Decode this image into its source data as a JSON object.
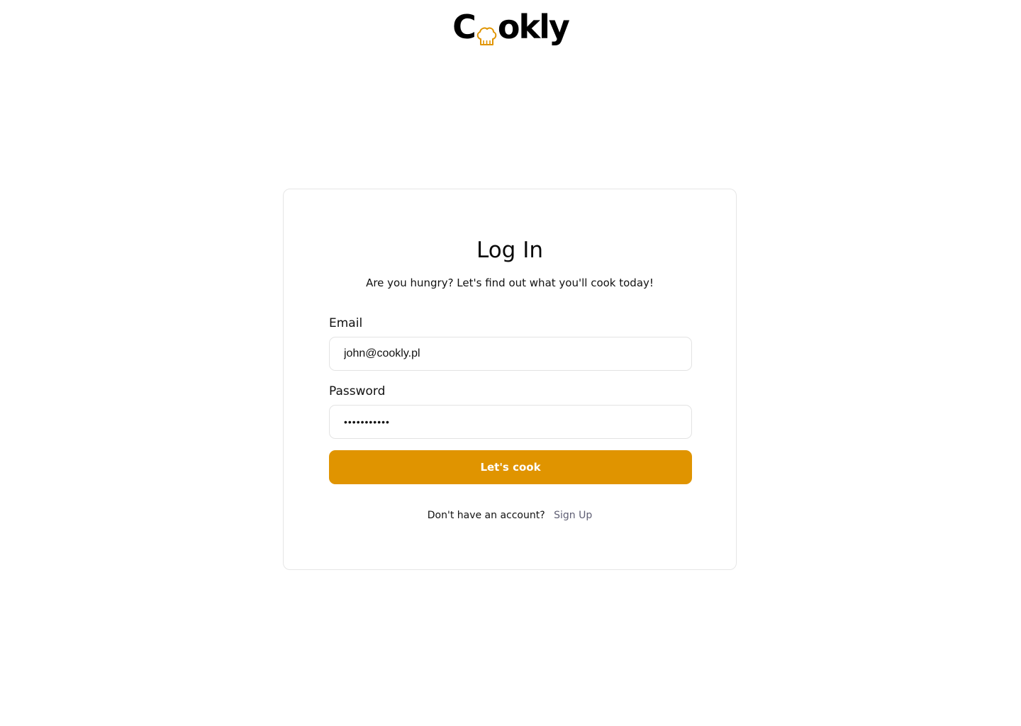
{
  "brand": {
    "name": "Cookly",
    "letters_before": "C",
    "letters_after": "okly",
    "accent_color": "#e09400"
  },
  "login": {
    "title": "Log In",
    "subtitle": "Are you hungry? Let's find out what you'll cook today!",
    "email_label": "Email",
    "email_value": "john@cookly.pl",
    "password_label": "Password",
    "password_value": "•••••••••••",
    "submit_label": "Let's cook",
    "signup_prompt": "Don't have an account?",
    "signup_link": "Sign Up"
  },
  "icons": {
    "logo_hat": "chef-hat-icon"
  },
  "colors": {
    "button": "#e09400",
    "link": "#5e5e73",
    "border": "#e3e3e3"
  }
}
